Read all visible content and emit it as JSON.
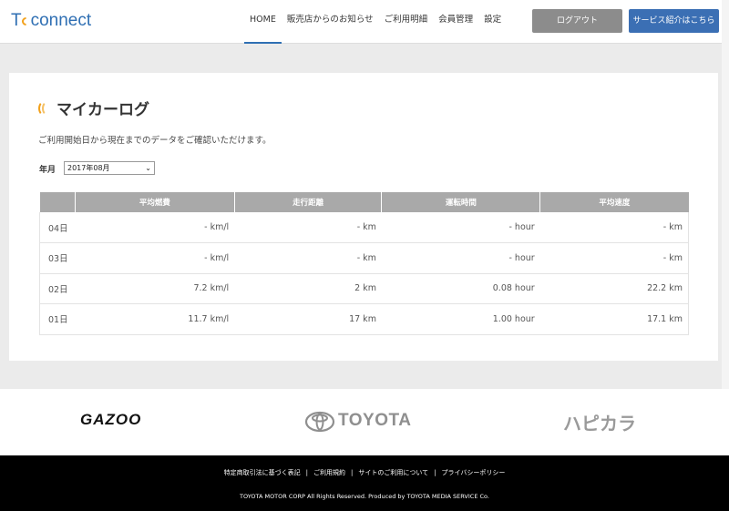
{
  "header": {
    "logo_t": "T",
    "logo_rest": "connect",
    "nav": [
      "HOME",
      "販売店からのお知らせ",
      "ご利用明細",
      "会員管理",
      "設定"
    ],
    "logout_label": "ログアウト",
    "service_label": "サービス紹介はこちら"
  },
  "main": {
    "title": "マイカーログ",
    "subtitle": "ご利用開始日から現在までのデータをご確認いただけます。",
    "ym_label": "年月",
    "ym_value": "2017年08月",
    "table": {
      "headers": [
        "",
        "平均燃費",
        "走行距離",
        "運転時間",
        "平均速度"
      ],
      "rows": [
        [
          "04日",
          "- km/l",
          "- km",
          "- hour",
          "- km"
        ],
        [
          "03日",
          "- km/l",
          "- km",
          "- hour",
          "- km"
        ],
        [
          "02日",
          "7.2 km/l",
          "2 km",
          "0.08 hour",
          "22.2 km"
        ],
        [
          "01日",
          "11.7 km/l",
          "17 km",
          "1.00 hour",
          "17.1 km"
        ]
      ]
    }
  },
  "brands": {
    "gazoo": "GAZOO",
    "toyota": "TOYOTA",
    "hapikara": "ハピカラ"
  },
  "footer": {
    "links": [
      "特定商取引法に基づく表記",
      "ご利用規約",
      "サイトのご利用について",
      "プライバシーポリシー"
    ],
    "copyright": "TOYOTA MOTOR CORP All Rights Reserved. Produced by TOYOTA MEDIA SERVICE Co."
  },
  "colors": {
    "brand_blue": "#2f6fb3",
    "accent_orange": "#f2a11c",
    "logout_gray": "#8c8c8c",
    "table_header_gray": "#a9a9a9"
  }
}
